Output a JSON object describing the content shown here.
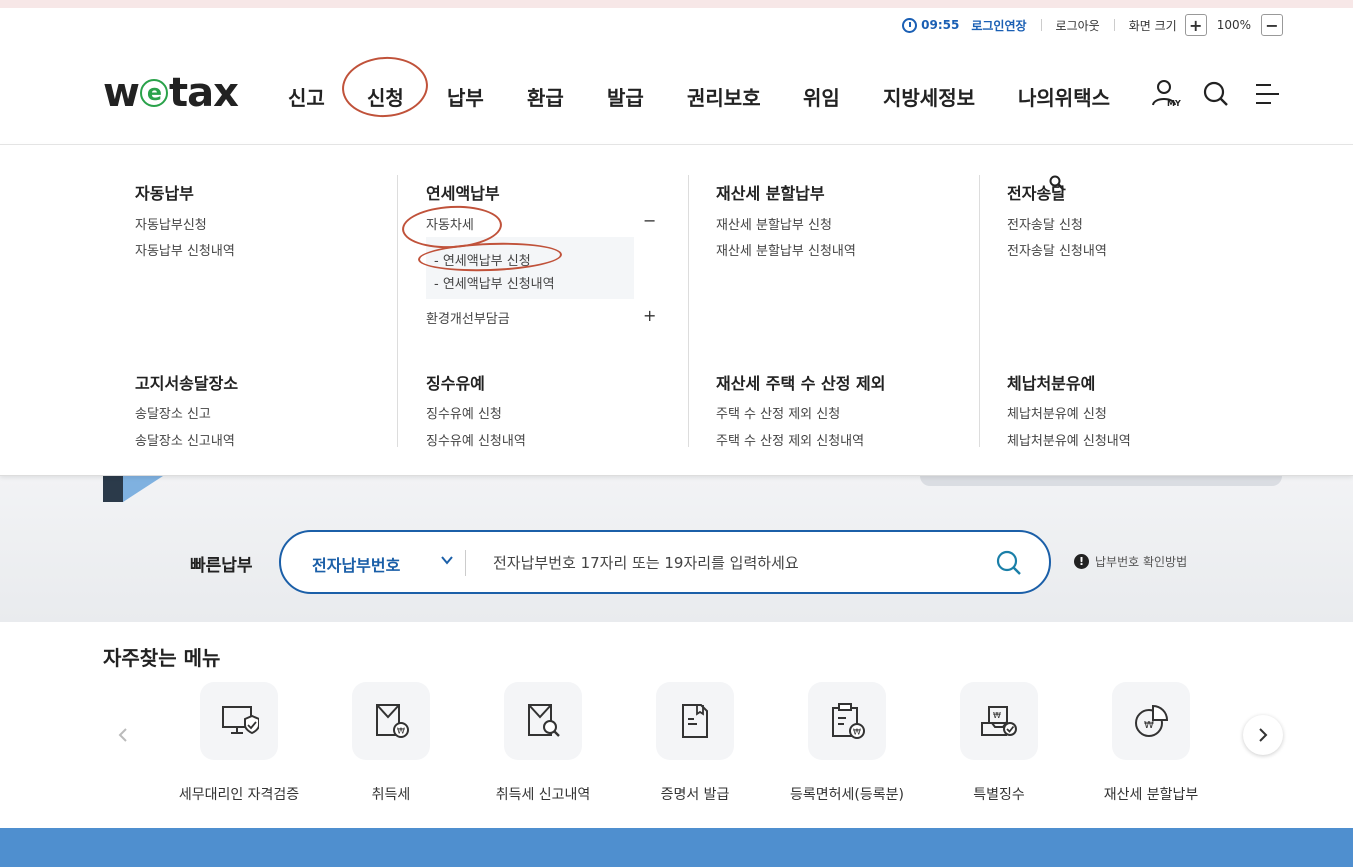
{
  "util": {
    "time": "09:55",
    "extend_label": "로그인연장",
    "logout_label": "로그아웃",
    "zoom_label": "화면 크기",
    "zoom_in": "+",
    "zoom_value": "100%",
    "zoom_out": "−"
  },
  "logo": {
    "pre": "w",
    "e": "e",
    "post": "tax"
  },
  "gnb": [
    "신고",
    "신청",
    "납부",
    "환급",
    "발급",
    "권리보호",
    "위임",
    "지방세정보",
    "나의위택스"
  ],
  "header_icons": {
    "my_label": "MY"
  },
  "mega": {
    "c1": {
      "title": "자동납부",
      "links": [
        "자동납부신청",
        "자동납부 신청내역"
      ]
    },
    "c2": {
      "title": "연세액납부",
      "item1": "자동차세",
      "item1_toggle": "−",
      "sub": [
        "연세액납부 신청",
        "연세액납부 신청내역"
      ],
      "item2": "환경개선부담금",
      "item2_toggle": "+"
    },
    "c3": {
      "title": "재산세 분할납부",
      "links": [
        "재산세 분할납부 신청",
        "재산세 분할납부 신청내역"
      ]
    },
    "c4": {
      "title": "전자송달",
      "links": [
        "전자송달 신청",
        "전자송달 신청내역"
      ]
    },
    "c5": {
      "title": "고지서송달장소",
      "links": [
        "송달장소 신고",
        "송달장소 신고내역"
      ]
    },
    "c6": {
      "title": "징수유예",
      "links": [
        "징수유예 신청",
        "징수유예 신청내역"
      ]
    },
    "c7": {
      "title": "재산세 주택 수 산정 제외",
      "links": [
        "주택 수 산정 제외 신청",
        "주택 수 산정 제외 신청내역"
      ]
    },
    "c8": {
      "title": "체납처분유예",
      "links": [
        "체납처분유예 신청",
        "체납처분유예 신청내역"
      ]
    }
  },
  "quickpay": {
    "label": "빠른납부",
    "select_value": "전자납부번호",
    "placeholder": "전자납부번호 17자리 또는 19자리를 입력하세요",
    "help": "납부번호 확인방법",
    "help_icon": "!"
  },
  "frequent": {
    "title": "자주찾는 메뉴",
    "items": [
      {
        "label": "세무대리인 자격검증",
        "icon": "monitor-shield-icon"
      },
      {
        "label": "취득세",
        "icon": "envelope-won-icon"
      },
      {
        "label": "취득세 신고내역",
        "icon": "envelope-search-icon"
      },
      {
        "label": "증명서 발급",
        "icon": "document-bookmark-icon"
      },
      {
        "label": "등록면허세(등록분)",
        "icon": "clipboard-won-icon"
      },
      {
        "label": "특별징수",
        "icon": "tray-check-icon"
      },
      {
        "label": "재산세 분할납부",
        "icon": "pie-won-icon"
      }
    ]
  }
}
